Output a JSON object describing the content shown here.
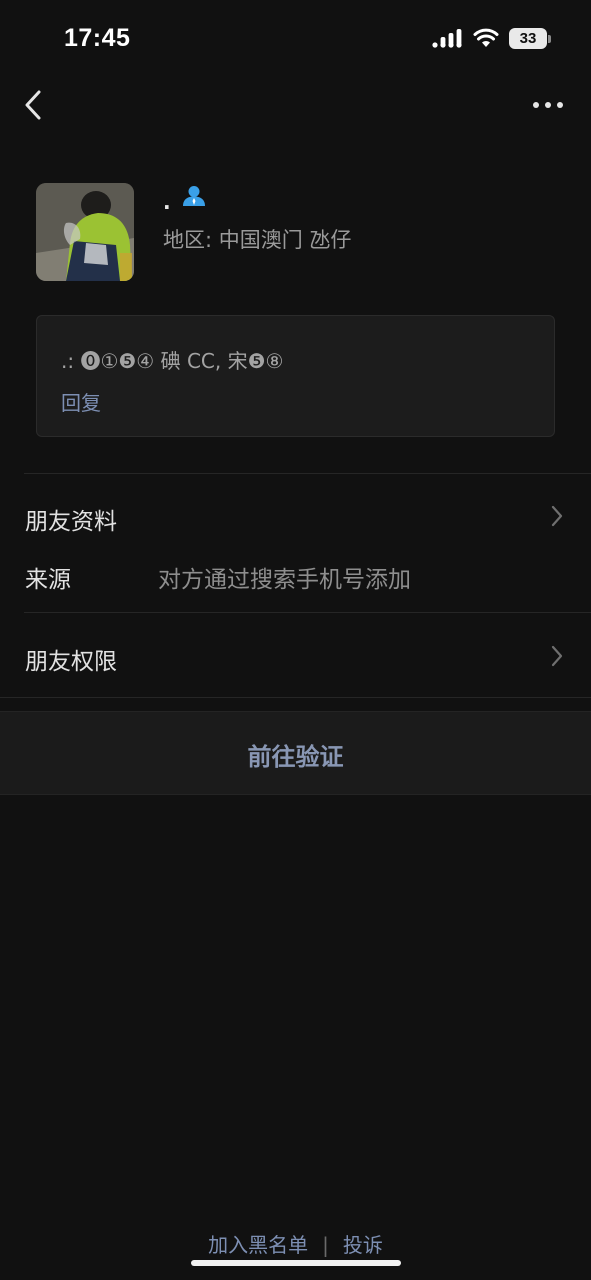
{
  "status_bar": {
    "time": "17:45",
    "battery": "33",
    "icons": [
      "signal-icon",
      "wifi-icon",
      "battery-icon"
    ]
  },
  "nav": {
    "back_icon": "chevron-left-icon",
    "more_icon": "more-dots-icon"
  },
  "profile": {
    "nickname": ".",
    "contact_icon": "contact-person-icon",
    "region": "地区: 中国澳门 氹仔"
  },
  "message": {
    "text": ".: ⓿①❺④ 碘 CC, 宋❺⑧",
    "reply": "回复"
  },
  "rows": {
    "friend_profile": "朋友资料",
    "source_label": "来源",
    "source_value": "对方通过搜索手机号添加",
    "permissions": "朋友权限"
  },
  "verify_button": "前往验证",
  "footer": {
    "blacklist": "加入黑名单",
    "separator": "|",
    "report": "投诉"
  },
  "colors": {
    "background": "#111111",
    "card": "#1c1c1c",
    "link": "#7d8fb3",
    "accent_blue": "#3aa0e8"
  }
}
